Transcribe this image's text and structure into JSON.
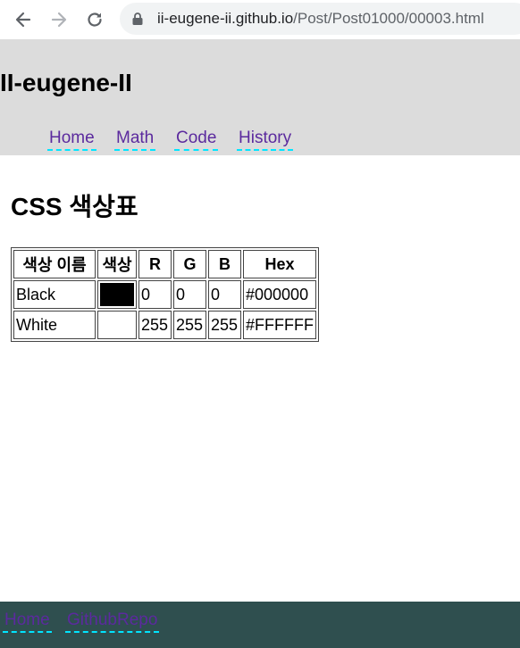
{
  "browser": {
    "url_domain": "ii-eugene-ii.github.io",
    "url_path": "/Post/Post01000/00003.html"
  },
  "site": {
    "title": "II-eugene-II",
    "nav": [
      "Home",
      "Math",
      "Code",
      "History"
    ]
  },
  "main": {
    "heading": "CSS 색상표",
    "table": {
      "headers": [
        "색상 이름",
        "색상",
        "R",
        "G",
        "B",
        "Hex"
      ],
      "rows": [
        {
          "name": "Black",
          "color": "#000000",
          "r": "0",
          "g": "0",
          "b": "0",
          "hex": "#000000"
        },
        {
          "name": "White",
          "color": "#FFFFFF",
          "r": "255",
          "g": "255",
          "b": "255",
          "hex": "#FFFFFF"
        }
      ]
    }
  },
  "footer": {
    "links": [
      "Home",
      "GithubRepo"
    ]
  },
  "colors": {
    "header_bg": "#dcdcdc",
    "footer_bg": "#2f4f4f",
    "link": "#5b2a9e",
    "link_underline": "#00e5ff"
  }
}
